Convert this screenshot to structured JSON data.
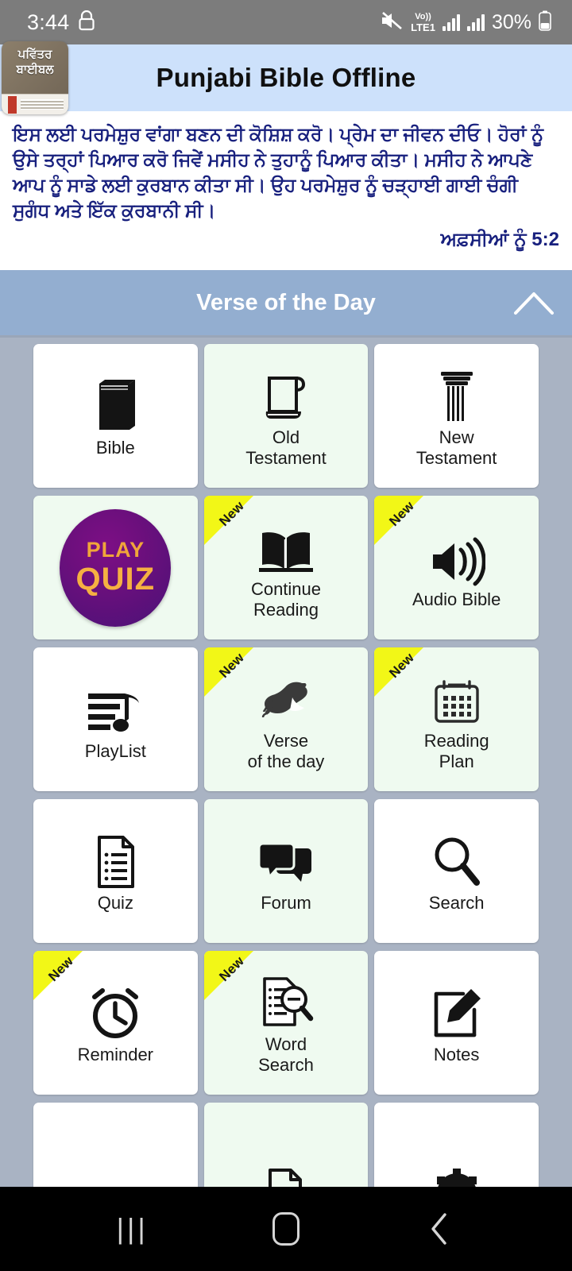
{
  "status_bar": {
    "time": "3:44",
    "lock_icon": "lock-icon",
    "mute_icon": "mute-icon",
    "volte_top": "Vo))",
    "volte_bottom": "LTE1",
    "signal_icon_1": "signal-bars-icon",
    "signal_icon_2": "signal-bars-icon",
    "battery_percent": "30%",
    "battery_icon": "battery-icon"
  },
  "header": {
    "title": "Punjabi Bible Offline",
    "app_icon_name": "punjabi-bible-app-icon",
    "app_icon_line1": "ਪਵਿੱਤਰ",
    "app_icon_line2": "ਬਾਈਬਲ",
    "background_color": "#cde1fb"
  },
  "verse": {
    "text": "ਇਸ ਲਈ ਪਰਮੇਸ਼ੁਰ ਵਾਂਗਾ ਬਣਨ ਦੀ ਕੋਸ਼ਿਸ਼ ਕਰੋ। ਪ੍ਰੇਮ ਦਾ ਜੀਵਨ ਦੀਓ। ਹੋਰਾਂ ਨੂੰ ਉਸੇ ਤਰ੍ਹਾਂ ਪਿਆਰ ਕਰੋ ਜਿਵੇਂ ਮਸੀਹ ਨੇ ਤੁਹਾਨੂੰ ਪਿਆਰ ਕੀਤਾ। ਮਸੀਹ ਨੇ ਆਪਣੇ ਆਪ ਨੂੰ ਸਾਡੇ ਲਈ ਕੁਰਬਾਨ ਕੀਤਾ ਸੀ। ਉਹ ਪਰਮੇਸ਼ੁਰ ਨੂੰ ਚੜ੍ਹਾਈ ਗਾਈ ਚੰਗੀ ਸੁਗੰਧ ਅਤੇ ਇੱਕ ਕੁਰਬਾਨੀ ਸੀ।",
    "reference": "ਅਫ਼ਸੀਆਂ ਨੂੰ 5:2",
    "text_color": "#18207e"
  },
  "votd": {
    "title": "Verse of the Day",
    "collapse_icon": "chevron-up-icon",
    "background_color": "#93aed0"
  },
  "grid": {
    "tiles": [
      {
        "label": "Bible",
        "icon": "closed-book-icon",
        "tint": "white",
        "new": false
      },
      {
        "label": "Old\nTestament",
        "icon": "scroll-icon",
        "tint": "green",
        "new": false
      },
      {
        "label": "New\nTestament",
        "icon": "pillar-icon",
        "tint": "white",
        "new": false
      },
      {
        "label": "",
        "icon": "play-quiz-badge",
        "tint": "green",
        "new": false,
        "badge_line1": "PLAY",
        "badge_line2": "QUIZ"
      },
      {
        "label": "Continue\nReading",
        "icon": "open-book-icon",
        "tint": "green",
        "new": true,
        "new_label": "New"
      },
      {
        "label": "Audio Bible",
        "icon": "speaker-icon",
        "tint": "green",
        "new": true,
        "new_label": "New"
      },
      {
        "label": "PlayList",
        "icon": "playlist-music-icon",
        "tint": "white",
        "new": false
      },
      {
        "label": "Verse\nof the day",
        "icon": "dove-icon",
        "tint": "green",
        "new": true,
        "new_label": "New"
      },
      {
        "label": "Reading\nPlan",
        "icon": "calendar-icon",
        "tint": "green",
        "new": true,
        "new_label": "New"
      },
      {
        "label": "Quiz",
        "icon": "document-list-icon",
        "tint": "white",
        "new": false
      },
      {
        "label": "Forum",
        "icon": "chat-bubbles-icon",
        "tint": "green",
        "new": false
      },
      {
        "label": "Search",
        "icon": "magnifier-icon",
        "tint": "white",
        "new": false
      },
      {
        "label": "Reminder",
        "icon": "alarm-clock-icon",
        "tint": "white",
        "new": true,
        "new_label": "New"
      },
      {
        "label": "Word\nSearch",
        "icon": "word-search-icon",
        "tint": "green",
        "new": true,
        "new_label": "New"
      },
      {
        "label": "Notes",
        "icon": "note-pencil-icon",
        "tint": "white",
        "new": false
      },
      {
        "label": "",
        "icon": "black-block-icon",
        "tint": "white",
        "new": false
      },
      {
        "label": "",
        "icon": "page-icon",
        "tint": "green",
        "new": false
      },
      {
        "label": "",
        "icon": "gear-icon",
        "tint": "white",
        "new": false
      }
    ]
  },
  "nav_bar": {
    "recents_icon": "recents-icon",
    "recents_glyph": "|||",
    "home_icon": "home-icon",
    "back_icon": "back-icon"
  }
}
